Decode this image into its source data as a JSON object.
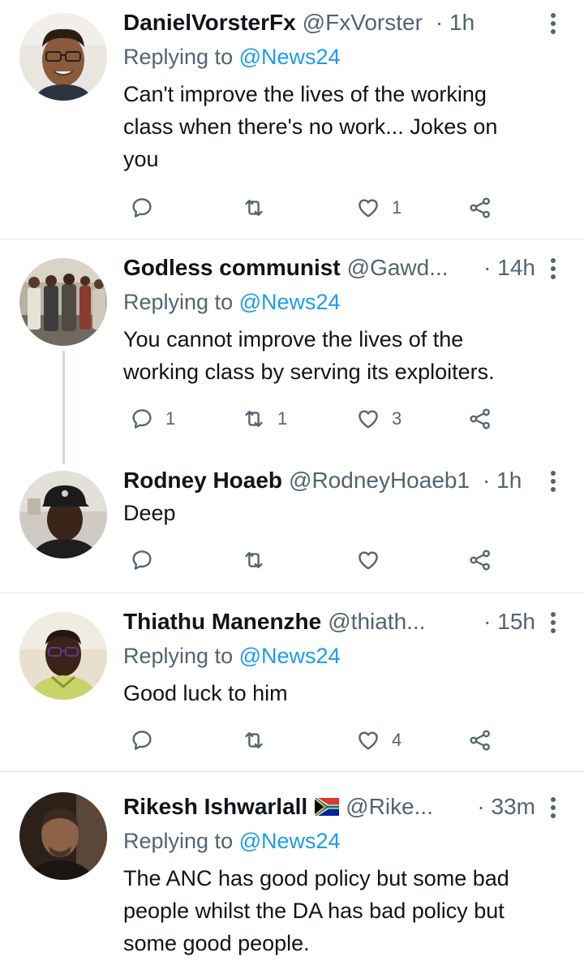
{
  "tweets": [
    {
      "name": "DanielVorsterFx",
      "handle": "@FxVorster",
      "time": "· 1h",
      "replying_prefix": "Replying to ",
      "replying_to": "@News24",
      "text": "Can't improve the lives of the working\nclass when there's no work... Jokes on\nyou",
      "replies": "",
      "retweets": "",
      "likes": "1"
    },
    {
      "name": "Godless communist",
      "handle": "@Gawd...",
      "time": "· 14h",
      "replying_prefix": "Replying to ",
      "replying_to": "@News24",
      "text": "You cannot improve the lives of the\nworking class by serving its  exploiters.",
      "replies": "1",
      "retweets": "1",
      "likes": "3"
    },
    {
      "name": "Rodney Hoaeb",
      "handle": "@RodneyHoaeb1",
      "time": "· 1h",
      "text": "Deep",
      "replies": "",
      "retweets": "",
      "likes": ""
    },
    {
      "name": "Thiathu Manenzhe",
      "handle": "@thiath...",
      "time": "· 15h",
      "replying_prefix": "Replying to ",
      "replying_to": "@News24",
      "text": "Good luck to him",
      "replies": "",
      "retweets": "",
      "likes": "4"
    },
    {
      "name": "Rikesh Ishwarlall",
      "handle": "@Rike...",
      "time": "· 33m",
      "replying_prefix": "Replying to ",
      "replying_to": "@News24",
      "text": "The ANC has good policy but some bad\npeople whilst the DA has bad policy but\nsome good people."
    }
  ],
  "icons": {
    "reply": "reply-icon",
    "retweet": "retweet-icon",
    "like": "heart-icon",
    "share": "share-icon",
    "more": "more-vertical-icon",
    "flag": "south-africa-flag-icon"
  },
  "colors": {
    "link": "#1d9bf0",
    "secondary": "#536471",
    "text": "#0f1419",
    "divider": "#e3e7ea",
    "thread_line": "#cfd9de"
  }
}
